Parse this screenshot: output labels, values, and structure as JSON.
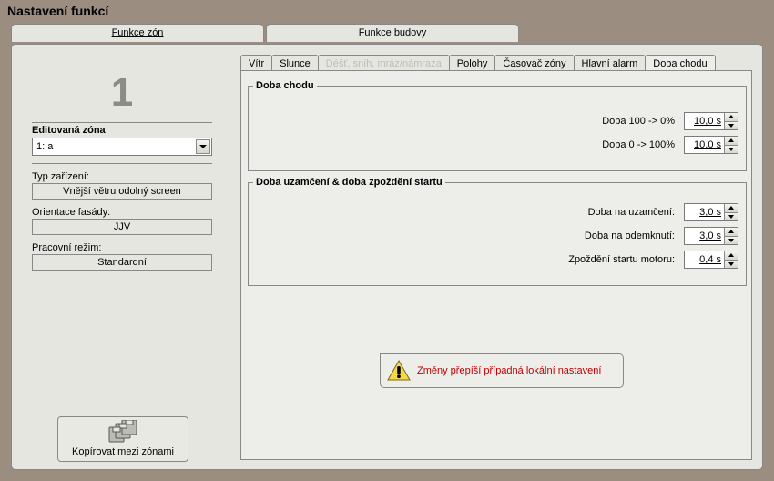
{
  "window": {
    "title": "Nastavení funkcí"
  },
  "top_tabs": {
    "zones": "Funkce zón",
    "building": "Funkce budovy"
  },
  "sidebar": {
    "zone_number": "1",
    "edited_zone_label": "Editovaná zóna",
    "edited_zone_value": "1: a",
    "device_type_label": "Typ zařízení:",
    "device_type_value": "Vnější větru odolný screen",
    "facade_orientation_label": "Orientace fasády:",
    "facade_orientation_value": "JJV",
    "work_mode_label": "Pracovní režim:",
    "work_mode_value": "Standardní",
    "copy_between_zones": "Kopírovat mezi zónami"
  },
  "sub_tabs": {
    "wind": "Vítr",
    "sun": "Slunce",
    "rain": "Déšť, sníh, mráz/námraza",
    "positions": "Polohy",
    "zone_timer": "Časovač zóny",
    "main_alarm": "Hlavní alarm",
    "run_time": "Doba chodu"
  },
  "group_run_time": {
    "title": "Doba chodu",
    "row1_label": "Doba 100 -> 0%",
    "row1_value": "10,0 s",
    "row2_label": "Doba 0 -> 100%",
    "row2_value": "10,0 s"
  },
  "group_lock": {
    "title": "Doba uzamčení & doba zpoždění startu",
    "row1_label": "Doba na uzamčení:",
    "row1_value": "3,0 s",
    "row2_label": "Doba na odemknutí:",
    "row2_value": "3,0 s",
    "row3_label": "Zpoždění startu motoru:",
    "row3_value": "0,4 s"
  },
  "warning": "Změny přepíší případná lokální nastavení"
}
